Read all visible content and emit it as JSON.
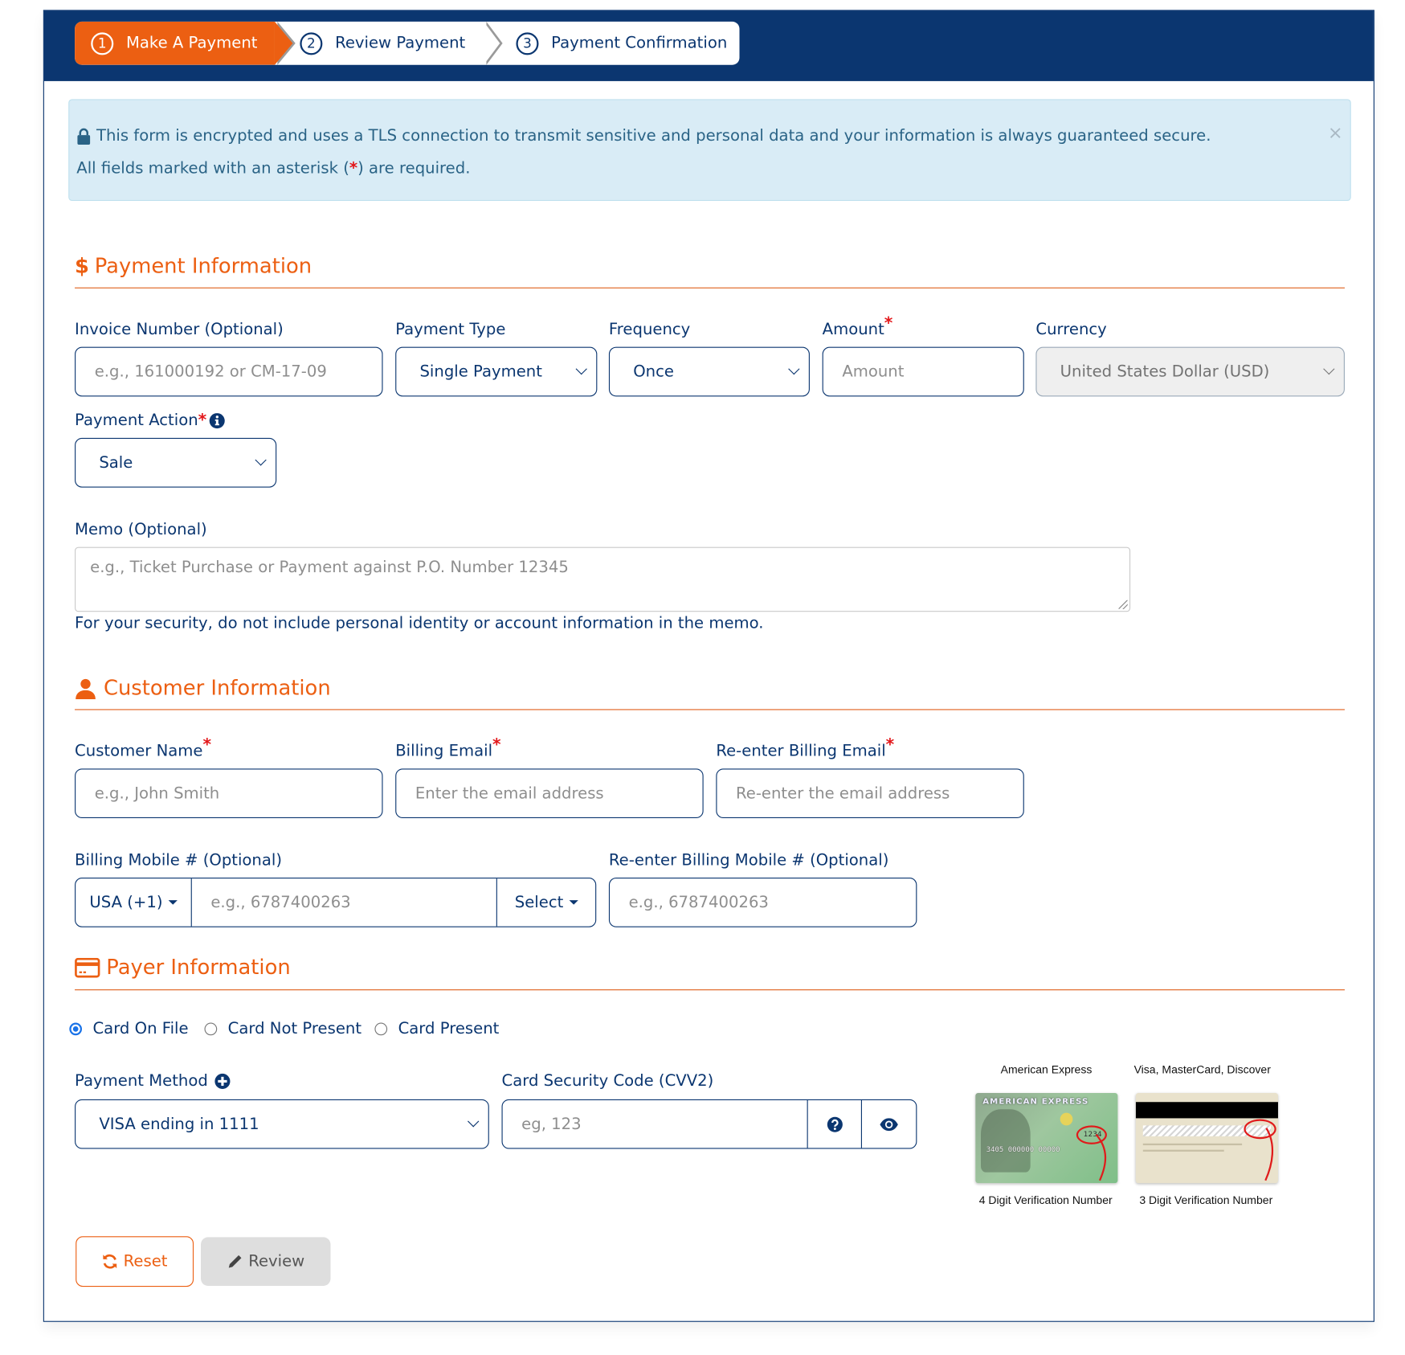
{
  "wizard": {
    "steps": [
      {
        "num": "1",
        "label": "Make A Payment",
        "active": true
      },
      {
        "num": "2",
        "label": "Review Payment",
        "active": false
      },
      {
        "num": "3",
        "label": "Payment Confirmation",
        "active": false
      }
    ]
  },
  "alert": {
    "line1": "This form is encrypted and uses a TLS connection to transmit sensitive and personal data and your information is always guaranteed secure.",
    "line2_prefix": "All fields marked with an asterisk (",
    "line2_asterisk": "*",
    "line2_suffix": ") are required.",
    "close": "×"
  },
  "payment_info": {
    "title": "Payment Information",
    "icon": "$",
    "invoice": {
      "label": "Invoice Number (Optional)",
      "placeholder": "e.g., 161000192 or CM-17-09"
    },
    "payment_type": {
      "label": "Payment Type",
      "value": "Single Payment"
    },
    "frequency": {
      "label": "Frequency",
      "value": "Once"
    },
    "amount": {
      "label": "Amount",
      "placeholder": "Amount",
      "required": "*"
    },
    "currency": {
      "label": "Currency",
      "value": "United States Dollar (USD)"
    },
    "payment_action": {
      "label": "Payment Action",
      "value": "Sale",
      "required": "*"
    },
    "memo": {
      "label": "Memo (Optional)",
      "placeholder": "e.g., Ticket Purchase or Payment against P.O. Number 12345",
      "hint": "For your security, do not include personal identity or account information in the memo."
    }
  },
  "customer_info": {
    "title": "Customer Information",
    "customer_name": {
      "label": "Customer Name",
      "placeholder": "e.g., John Smith",
      "required": "*"
    },
    "billing_email": {
      "label": "Billing Email",
      "placeholder": "Enter the email address",
      "required": "*"
    },
    "reenter_email": {
      "label": "Re-enter Billing Email",
      "placeholder": "Re-enter the email address",
      "required": "*"
    },
    "mobile": {
      "label": "Billing Mobile # (Optional)",
      "country": "USA (+1)",
      "placeholder": "e.g., 6787400263",
      "type": "Select"
    },
    "reenter_mobile": {
      "label": "Re-enter Billing Mobile # (Optional)",
      "placeholder": "e.g., 6787400263"
    }
  },
  "payer_info": {
    "title": "Payer Information",
    "radios": [
      {
        "label": "Card On File",
        "checked": true
      },
      {
        "label": "Card Not Present",
        "checked": false
      },
      {
        "label": "Card Present",
        "checked": false
      }
    ],
    "payment_method": {
      "label": "Payment Method",
      "value": "VISA ending in 1111"
    },
    "cvv": {
      "label": "Card Security Code (CVV2)",
      "placeholder": "eg, 123"
    },
    "cards": {
      "amex_title": "American Express",
      "amex_caption": "4 Digit Verification Number",
      "amex_code": "1234",
      "amex_brand": "AMERICAN EXPRESS",
      "amex_number": "3405 000000 00000",
      "visa_title": "Visa, MasterCard, Discover",
      "visa_caption": "3 Digit Verification Number"
    }
  },
  "actions": {
    "reset": "Reset",
    "review": "Review"
  }
}
